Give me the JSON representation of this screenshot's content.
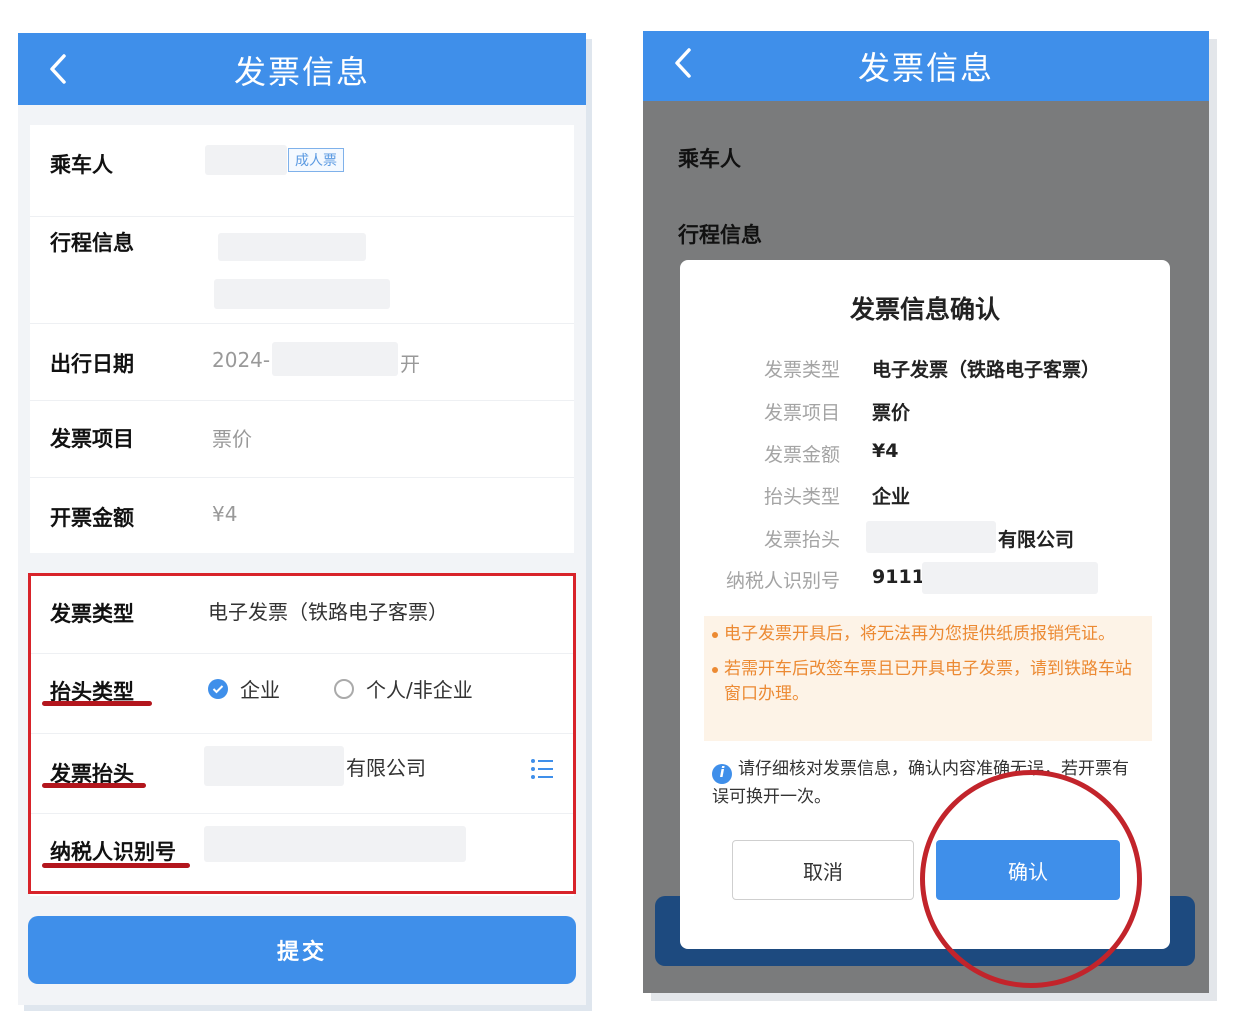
{
  "left": {
    "header": {
      "title": "发票信息"
    },
    "passenger": {
      "label": "乘车人",
      "ticket_tag": "成人票"
    },
    "trip": {
      "label": "行程信息"
    },
    "date": {
      "label": "出行日期",
      "prefix": "2024-",
      "suffix": "开"
    },
    "item": {
      "label": "发票项目",
      "value": "票价"
    },
    "amount": {
      "label": "开票金额",
      "value": "¥4"
    },
    "invoice_type": {
      "label": "发票类型",
      "value": "电子发票（铁路电子客票）"
    },
    "header_type": {
      "label": "抬头类型",
      "option_company": "企业",
      "option_personal": "个人/非企业",
      "selected": "企业"
    },
    "invoice_header": {
      "label": "发票抬头",
      "suffix": "有限公司"
    },
    "tax_id": {
      "label": "纳税人识别号"
    },
    "submit_label": "提交"
  },
  "right": {
    "header": {
      "title": "发票信息"
    },
    "bg_labels": {
      "passenger": "乘车人",
      "trip": "行程信息"
    },
    "dialog": {
      "title": "发票信息确认",
      "rows": [
        {
          "label": "发票类型",
          "value": "电子发票（铁路电子客票）"
        },
        {
          "label": "发票项目",
          "value": "票价"
        },
        {
          "label": "发票金额",
          "value": "¥4"
        },
        {
          "label": "抬头类型",
          "value": "企业"
        },
        {
          "label": "发票抬头",
          "value": "有限公司"
        },
        {
          "label": "纳税人识别号",
          "value": "9111"
        }
      ],
      "notices": [
        "电子发票开具后，将无法再为您提供纸质报销凭证。",
        "若需开车后改签车票且已开具电子发票，请到铁路车站窗口办理。"
      ],
      "info": "请仔细核对发票信息，确认内容准确无误，若开票有误可换开一次。",
      "cancel_label": "取消",
      "confirm_label": "确认"
    }
  },
  "colors": {
    "primary": "#3f8fea",
    "highlight": "#d8232a",
    "warning": "#ec8a33"
  }
}
